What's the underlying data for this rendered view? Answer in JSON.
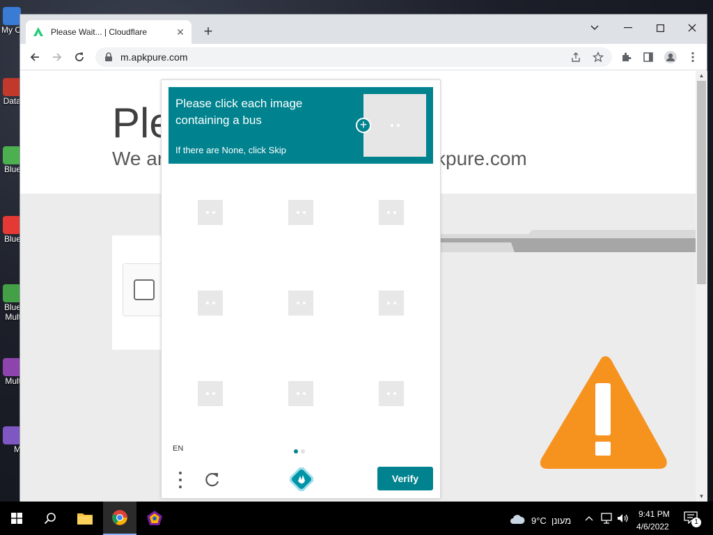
{
  "desktop": {
    "icons": [
      {
        "label": "My C"
      },
      {
        "label": "Data"
      },
      {
        "label": "Blue"
      },
      {
        "label": "Blue"
      },
      {
        "label": "Blue\nMult"
      },
      {
        "label": "Mult"
      },
      {
        "label": "M"
      }
    ]
  },
  "browser": {
    "tab_title": "Please Wait... | Cloudflare",
    "new_tab_symbol": "+",
    "url": "m.apkpure.com",
    "window_controls": [
      "chevron-down-icon",
      "minimize-icon",
      "maximize-icon",
      "close-icon"
    ]
  },
  "page": {
    "heading_fragment": "Ple",
    "sub_fragment_left": "We ar",
    "sub_fragment_right": "kpure.com"
  },
  "captcha": {
    "prompt_line1": "Please click each image",
    "prompt_line2": "containing a bus",
    "prompt_sub": "If there are None, click Skip",
    "language": "EN",
    "verify_label": "Verify",
    "accent_color": "#00838f",
    "grid_rows": 3,
    "grid_cols": 3
  },
  "taskbar": {
    "weather_temp": "9°C",
    "weather_text": "מעונן",
    "time": "9:41 PM",
    "date": "4/6/2022",
    "notification_count": "1"
  }
}
